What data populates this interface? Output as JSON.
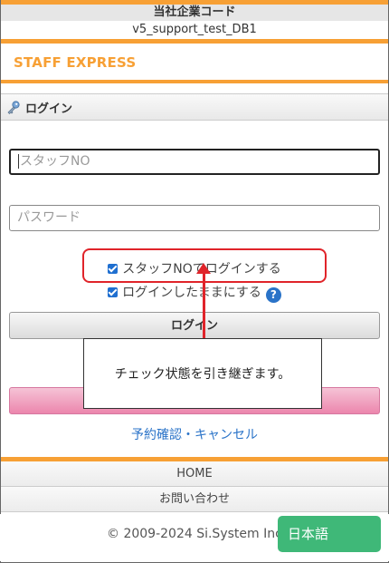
{
  "company": {
    "label": "当社企業コード",
    "value": "v5_support_test_DB1"
  },
  "brand": {
    "name": "STAFF EXPRESS",
    "color": "#f7a035"
  },
  "login_section": {
    "title": "ログイン",
    "icon": "key-icon"
  },
  "form": {
    "staff_no_placeholder": "スタッフNO",
    "password_placeholder": "パスワード",
    "options": [
      {
        "label": "スタッフNOでログインする",
        "checked": true
      },
      {
        "label": "ログインしたままにする",
        "checked": true
      }
    ],
    "help_symbol": "?",
    "login_button": "ログイン"
  },
  "callout": {
    "text": "チェック状態を引き継ぎます。"
  },
  "links": {
    "reservation": "予約確認・キャンセル"
  },
  "nav": {
    "home": "HOME",
    "contact": "お問い合わせ"
  },
  "footer": {
    "copyright": "© 2009-2024 Si.System Inc",
    "language_button": "日本語"
  },
  "colors": {
    "accent": "#f7a035",
    "highlight": "#e0242a",
    "link": "#2a73c8",
    "language": "#3fb878"
  }
}
